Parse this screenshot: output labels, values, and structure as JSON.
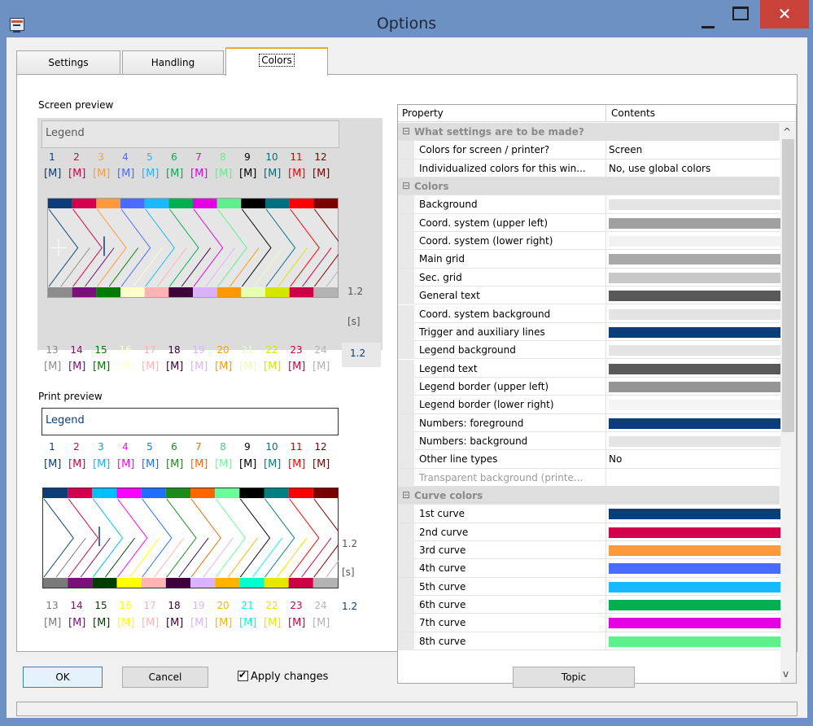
{
  "window": {
    "title": "Options",
    "close_glyph": "✕"
  },
  "tabs": [
    "Settings",
    "Handling",
    "Colors"
  ],
  "screen_preview": {
    "label": "Screen preview",
    "legend": "Legend",
    "top_nums": [
      "1",
      "2",
      "3",
      "4",
      "5",
      "6",
      "7",
      "8",
      "9",
      "10",
      "11",
      "12"
    ],
    "bottom_nums": [
      "13",
      "14",
      "15",
      "16",
      "17",
      "18",
      "19",
      "20",
      "21",
      "22",
      "23",
      "24"
    ],
    "symbol": "[M]",
    "right_val": "1.2",
    "unit": "[s]",
    "right_val2": "1.2"
  },
  "print_preview": {
    "label": "Print preview",
    "legend": "Legend",
    "top_nums": [
      "1",
      "2",
      "3",
      "4",
      "5",
      "6",
      "7",
      "8",
      "9",
      "10",
      "11",
      "12"
    ],
    "bottom_nums": [
      "13",
      "14",
      "15",
      "16",
      "17",
      "18",
      "19",
      "20",
      "21",
      "22",
      "23",
      "24"
    ],
    "symbol": "[M]",
    "right_val": "1.2",
    "unit": "[s]",
    "right_val2": "1.2"
  },
  "colors": {
    "screen_top": [
      "#0b3d7a",
      "#d4004c",
      "#ff9a3c",
      "#4a6bff",
      "#19b8ff",
      "#00b050",
      "#e600e6",
      "#5ef08a",
      "#000000",
      "#006f80",
      "#ff0000",
      "#7a0000"
    ],
    "screen_bottom": [
      "#8c8c8c",
      "#7a0f7a",
      "#007a00",
      "#ffffcc",
      "#ffb3b3",
      "#3d003d",
      "#d9b3ff",
      "#ff9900",
      "#e6ffb3",
      "#d4e600",
      "#cc0044",
      "#b3b3b3"
    ],
    "print_top": [
      "#0b3d7a",
      "#d4004c",
      "#00bfff",
      "#ff00ff",
      "#1e6fff",
      "#1a8c1a",
      "#ff6600",
      "#66ff99",
      "#000000",
      "#008080",
      "#ff0000",
      "#7a0000"
    ],
    "print_bottom": [
      "#7a7a7a",
      "#7a0f7a",
      "#003d00",
      "#ffff00",
      "#ffb3b3",
      "#3d003d",
      "#d9b3ff",
      "#ffb300",
      "#00ffcc",
      "#e6e600",
      "#cc0044",
      "#b3b3b3"
    ]
  },
  "property_grid": {
    "header": {
      "property": "Property",
      "contents": "Contents"
    },
    "rows": [
      {
        "type": "cat",
        "name": "What settings are to be made?",
        "toggle": "⊟"
      },
      {
        "type": "text",
        "name": "Colors for screen / printer?",
        "value": "Screen"
      },
      {
        "type": "text",
        "name": "Individualized colors for this win...",
        "value": "No, use global colors"
      },
      {
        "type": "cat",
        "name": "Colors",
        "toggle": "⊟"
      },
      {
        "type": "color",
        "name": "Background",
        "color": "#e4e4e4"
      },
      {
        "type": "color",
        "name": "Coord. system (upper left)",
        "color": "#a0a0a0"
      },
      {
        "type": "color",
        "name": "Coord. system (lower right)",
        "color": "#f2f2f2"
      },
      {
        "type": "color",
        "name": "Main grid",
        "color": "#a9a9a9"
      },
      {
        "type": "color",
        "name": "Sec. grid",
        "color": "#c8c8c8"
      },
      {
        "type": "color",
        "name": "General text",
        "color": "#595959"
      },
      {
        "type": "color",
        "name": "Coord. system background",
        "color": "#e4e4e4"
      },
      {
        "type": "color",
        "name": "Trigger and auxiliary lines",
        "color": "#0b3d7a"
      },
      {
        "type": "color",
        "name": "Legend background",
        "color": "#e4e4e4"
      },
      {
        "type": "color",
        "name": "Legend text",
        "color": "#595959"
      },
      {
        "type": "color",
        "name": "Legend border (upper left)",
        "color": "#959595"
      },
      {
        "type": "color",
        "name": "Legend border (lower right)",
        "color": "#f5f5f5"
      },
      {
        "type": "color",
        "name": "Numbers: foreground",
        "color": "#0b3d7a"
      },
      {
        "type": "color",
        "name": "Numbers: background",
        "color": "#e4e4e4"
      },
      {
        "type": "text",
        "name": "Other line types",
        "value": "No"
      },
      {
        "type": "disabled",
        "name": "Transparent background (printe...",
        "value": ""
      },
      {
        "type": "cat",
        "name": "Curve colors",
        "toggle": "⊟"
      },
      {
        "type": "color",
        "name": "1st curve",
        "color": "#0b3d7a"
      },
      {
        "type": "color",
        "name": "2nd curve",
        "color": "#d4004c"
      },
      {
        "type": "color",
        "name": "3rd curve",
        "color": "#ff9a3c"
      },
      {
        "type": "color",
        "name": "4th curve",
        "color": "#4a6bff"
      },
      {
        "type": "color",
        "name": "5th curve",
        "color": "#19b8ff"
      },
      {
        "type": "color",
        "name": "6th curve",
        "color": "#00b050"
      },
      {
        "type": "color",
        "name": "7th curve",
        "color": "#e600e6"
      },
      {
        "type": "color",
        "name": "8th curve",
        "color": "#5ef08a"
      }
    ],
    "scroll_up": "^",
    "scroll_down": "v"
  },
  "buttons": {
    "ok": "OK",
    "cancel": "Cancel",
    "apply": "Apply changes",
    "topic": "Topic"
  }
}
